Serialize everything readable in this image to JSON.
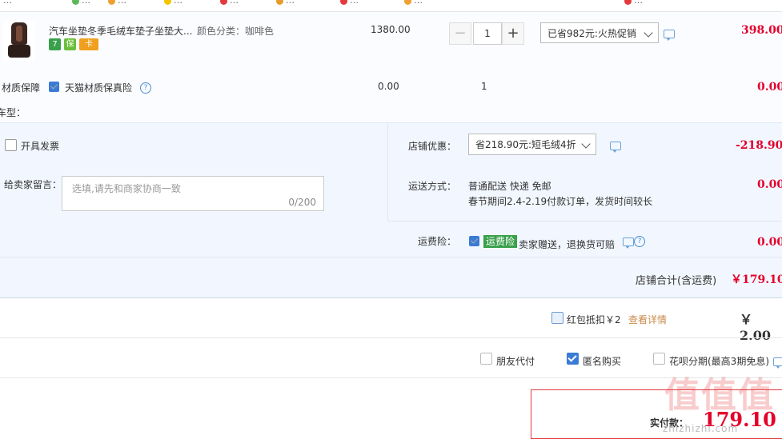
{
  "topbar": {
    "items": [
      "…",
      "…",
      "…",
      "…",
      "…",
      "…",
      "…",
      "…",
      "…"
    ]
  },
  "item": {
    "title": "汽车坐垫冬季毛绒车垫子坐垫大...",
    "spec": "颜色分类：咖啡色",
    "badges": [
      "7",
      "保",
      "卡"
    ],
    "unit_price": "1380.00",
    "quantity": "1",
    "promo_select": "已省982元:火热促销",
    "subtotal": "398.00"
  },
  "insurance": {
    "label": "材质保障",
    "name": "天猫材质保真险",
    "price": "0.00",
    "quantity": "1",
    "subtotal": "0.00"
  },
  "car_model_label": "车型：",
  "invoice_label": "开具发票",
  "message": {
    "label": "给卖家留言：",
    "placeholder": "选填,请先和商家协商一致",
    "counter": "0/200"
  },
  "shop_discount": {
    "label": "店铺优惠：",
    "select": "省218.90元:短毛绒4折",
    "amount": "-218.90"
  },
  "shipping": {
    "label": "运送方式：",
    "method": "普通配送 快递 免邮",
    "note": "春节期间2.4-2.19付款订单，发货时间较长",
    "amount": "0.00"
  },
  "freight_insurance": {
    "label": "运费险：",
    "tag": "运费险",
    "text": "卖家赠送，退换货可赔",
    "amount": "0.00"
  },
  "shop_total": {
    "label": "店铺合计(含运费)",
    "value": "￥179.10"
  },
  "red_packet": {
    "label": "红包抵扣￥2",
    "details_link": "查看详情",
    "value": "￥ 2.00"
  },
  "options": {
    "friend_pay": "朋友代付",
    "anonymous": "匿名购买",
    "huabei": "花呗分期(最高3期免息)"
  },
  "payment": {
    "label": "实付款：",
    "amount": "179.10"
  },
  "watermark": {
    "logo": "值值值",
    "url": "zhizhizhi.com"
  },
  "colors": {
    "price_red": "#e4002b",
    "panel_bg": "#f2f7ff",
    "accent_blue": "#3a7bd5",
    "tag_green": "#39a04c"
  }
}
